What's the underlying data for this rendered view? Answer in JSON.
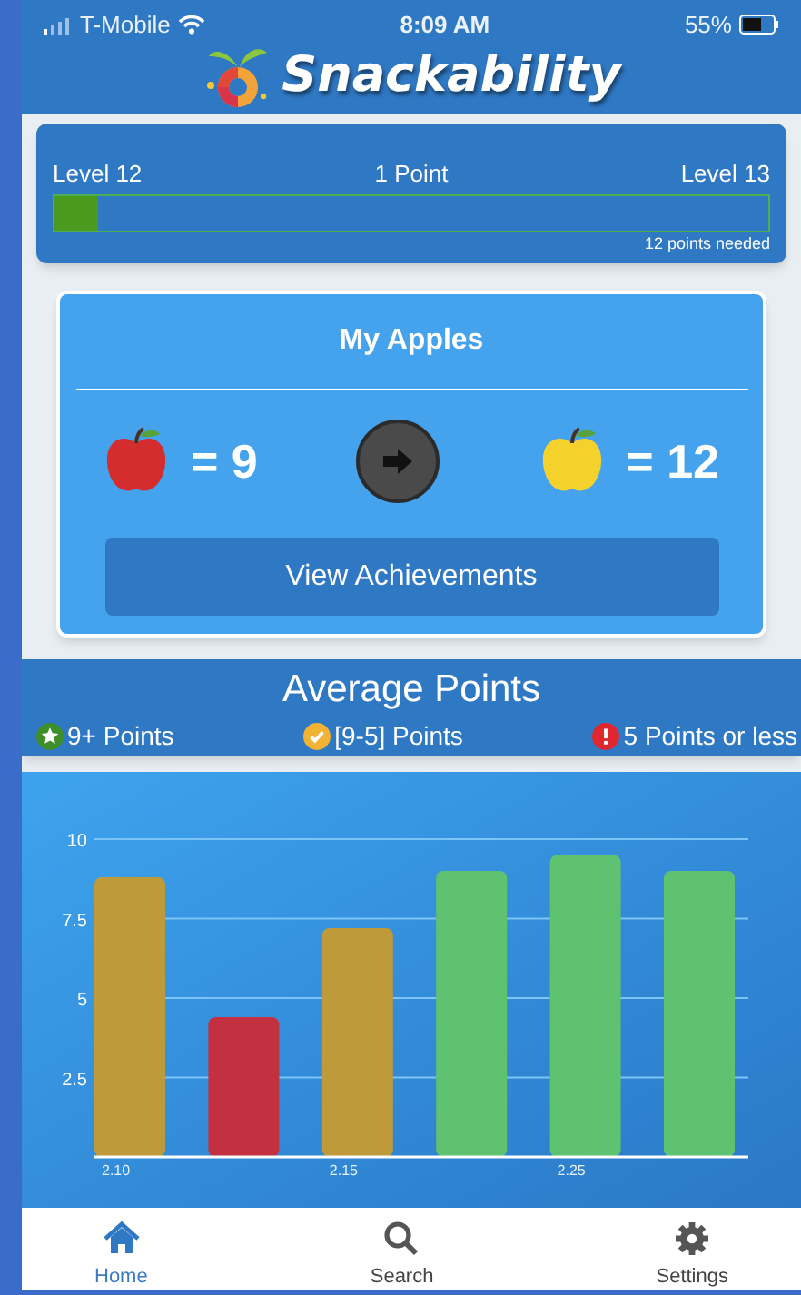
{
  "status_bar": {
    "carrier": "T-Mobile",
    "time": "8:09 AM",
    "battery": "55%"
  },
  "app_title": "Snackability",
  "level_progress": {
    "current_level": "Level 12",
    "points": "1 Point",
    "next_level": "Level 13",
    "level": 0.06,
    "needed": "12 points needed"
  },
  "apples_card": {
    "title": "My Apples",
    "red_count": "= 9",
    "yellow_count": "= 12",
    "button": "View Achievements"
  },
  "average_points": {
    "title": "Average Points",
    "legend": [
      {
        "kind": "star",
        "label": "9+ Points",
        "color": "#3e8e2a"
      },
      {
        "kind": "check",
        "label": "[9-5] Points",
        "color": "#f2b233"
      },
      {
        "kind": "alert",
        "label": "5 Points or less",
        "color": "#e0262e"
      }
    ],
    "chart_data": {
      "type": "bar",
      "categories": [
        "2.10",
        null,
        "2.15",
        null,
        "2.25",
        null
      ],
      "grid": true,
      "ylim": [
        0,
        10
      ],
      "yticks": [
        2.5,
        5,
        7.5,
        10
      ],
      "values": [
        8.8,
        4.4,
        7.2,
        9,
        9.5,
        9
      ]
    }
  },
  "tab_bar": [
    {
      "kind": "home",
      "label": "Home",
      "selected": true
    },
    {
      "kind": "search",
      "label": "Search",
      "selected": false
    },
    {
      "kind": "settings",
      "label": "Settings",
      "selected": false
    }
  ]
}
